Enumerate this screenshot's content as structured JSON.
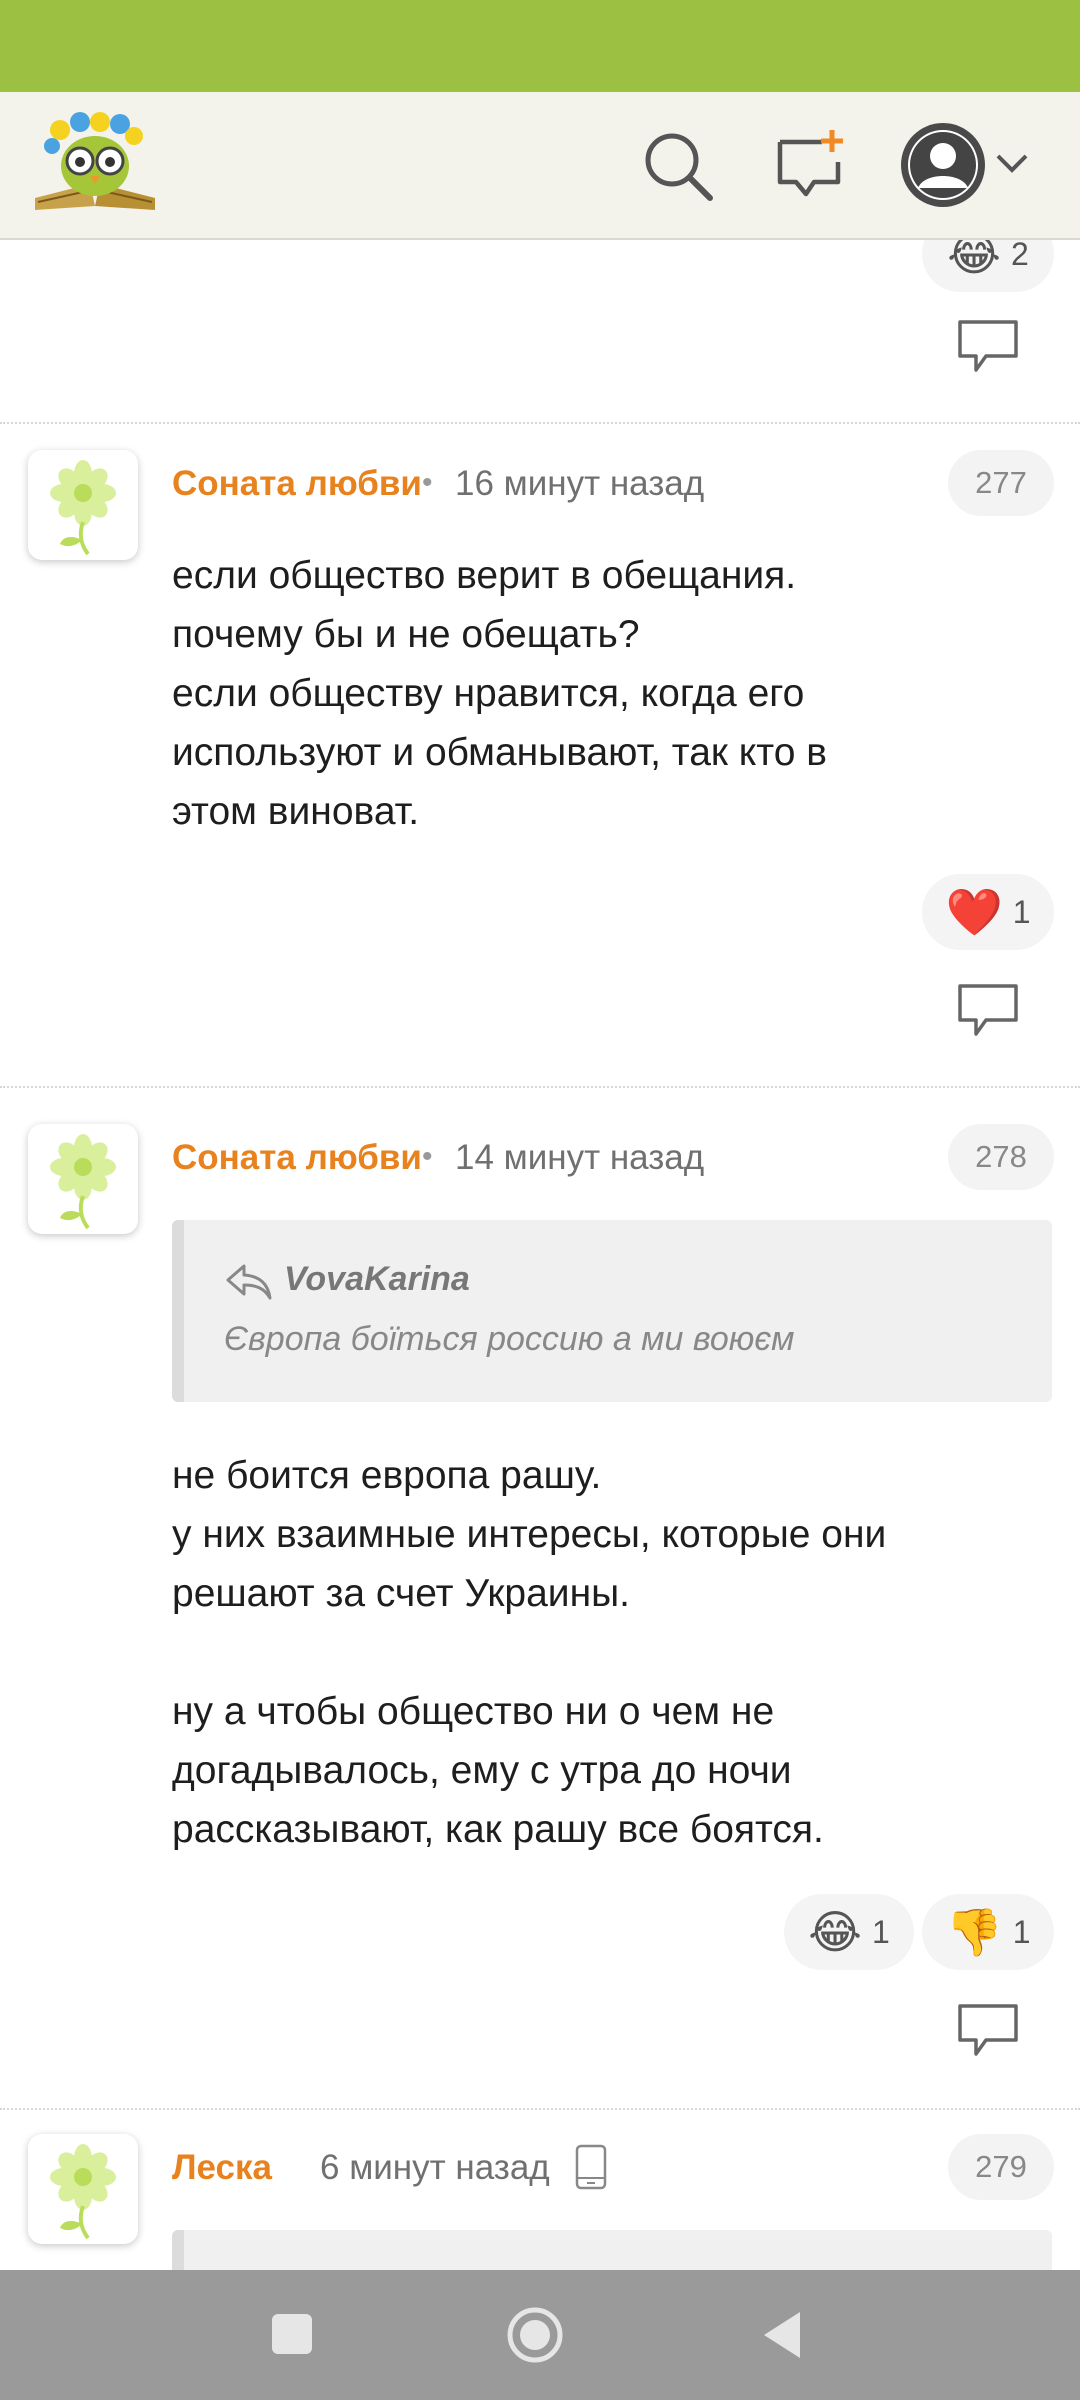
{
  "theme": {
    "accent": "#9cc142",
    "author_color": "#e8821e"
  },
  "header": {
    "logo_icon": "owl-logo-icon",
    "search_icon": "search-icon",
    "new_post_icon": "add-comment-icon",
    "profile_icon": "user-avatar-icon",
    "menu_icon": "chevron-down-icon"
  },
  "top_partial": {
    "reaction_count": "2"
  },
  "comments": [
    {
      "author": "Соната любви",
      "time": "16 минут назад",
      "number": "277",
      "lines": [
        "если общество верит в обещания.",
        "почему бы и не обещать?",
        "если обществу нравится, когда его",
        "используют и обманывают, так кто в",
        "этом виноват."
      ],
      "reactions": [
        {
          "emoji": "❤️",
          "icon": "heart-icon",
          "count": "1"
        }
      ]
    },
    {
      "author": "Соната любви",
      "time": "14 минут назад",
      "number": "278",
      "quote": {
        "author": "VovaKarina",
        "text": "Європа боїться россию а ми воюєм"
      },
      "lines": [
        "не боится европа рашу.",
        "у них взаимные интересы, которые они",
        "решают за счет Украины.",
        "",
        "ну а чтобы общество ни о чем не",
        "догадывалось, ему с утра до ночи",
        "рассказывают, как рашу все боятся."
      ],
      "reactions": [
        {
          "emoji": "😂",
          "icon": "laughing-icon",
          "count": "1"
        },
        {
          "emoji": "👎",
          "icon": "thumbs-down-icon",
          "count": "1"
        }
      ]
    },
    {
      "author": "Леска",
      "time": "6 минут назад",
      "number": "279"
    }
  ]
}
